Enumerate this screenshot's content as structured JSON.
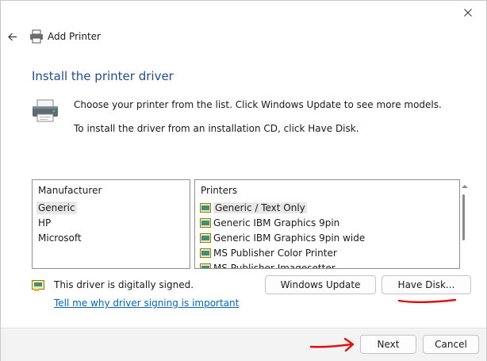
{
  "window": {
    "title": "Add Printer"
  },
  "page": {
    "heading": "Install the printer driver",
    "description_line1": "Choose your printer from the list. Click Windows Update to see more models.",
    "description_line2": "To install the driver from an installation CD, click Have Disk."
  },
  "manufacturers": {
    "header": "Manufacturer",
    "items": [
      "Generic",
      "HP",
      "Microsoft"
    ],
    "selected": "Generic"
  },
  "printers": {
    "header": "Printers",
    "items": [
      "Generic / Text Only",
      "Generic IBM Graphics 9pin",
      "Generic IBM Graphics 9pin wide",
      "MS Publisher Color Printer",
      "MS Publisher Imagesetter"
    ],
    "selected": "Generic / Text Only"
  },
  "signing": {
    "status": "This driver is digitally signed.",
    "link": "Tell me why driver signing is important"
  },
  "buttons": {
    "windows_update": "Windows Update",
    "have_disk": "Have Disk...",
    "next": "Next",
    "cancel": "Cancel"
  },
  "icons": {
    "back": "back-arrow-icon",
    "close": "close-icon",
    "printer": "printer-icon"
  },
  "colors": {
    "heading": "#1f4e96",
    "link": "#0066cc",
    "annotation": "#e01010"
  }
}
